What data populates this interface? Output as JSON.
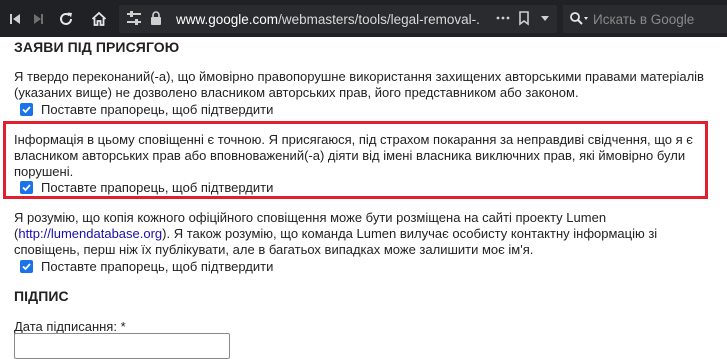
{
  "browser": {
    "url_host": "www.google.com",
    "url_path": "/webmasters/tools/legal-removal-...",
    "search_placeholder": "Искать в Google"
  },
  "form": {
    "oath_heading": "ЗАЯВИ ПІД ПРИСЯГОЮ",
    "statement1": "Я твердо переконаний(-а), що ймовірно правопорушне використання захищених авторськими правами матеріалів (указаних вище) не дозволено власником авторських прав, його представником або законом.",
    "checkbox1_label": "Поставте прапорець, щоб підтвердити",
    "statement2": "Інформація в цьому сповіщенні є точною. Я присягаюся, під страхом покарання за неправдиві свідчення, що я є власником авторських прав або вповноважений(-а) діяти від імені власника виключних прав, які ймовірно були порушені.",
    "checkbox2_label": "Поставте прапорець, щоб підтвердити",
    "statement3_before": "Я розумію, що копія кожного офіційного сповіщення може бути розміщена на сайті проекту Lumen (",
    "statement3_link": "http://lumendatabase.org",
    "statement3_after": "). Я також розумію, що команда Lumen вилучає особисту контактну інформацію зі сповіщень, перш ніж їх публікувати, але в багатьох випадках може залишити моє ім'я.",
    "checkbox3_label": "Поставте прапорець, щоб підтвердити",
    "signature_heading": "ПІДПИС",
    "date_label": "Дата підписання: *",
    "date_value": "",
    "checkbox1_checked": true,
    "checkbox2_checked": true,
    "checkbox3_checked": true
  },
  "colors": {
    "toolbar_bg": "#202124",
    "highlight_border": "#e0202e",
    "checkbox_accent": "#1a73e8",
    "link": "#1a0dab"
  }
}
